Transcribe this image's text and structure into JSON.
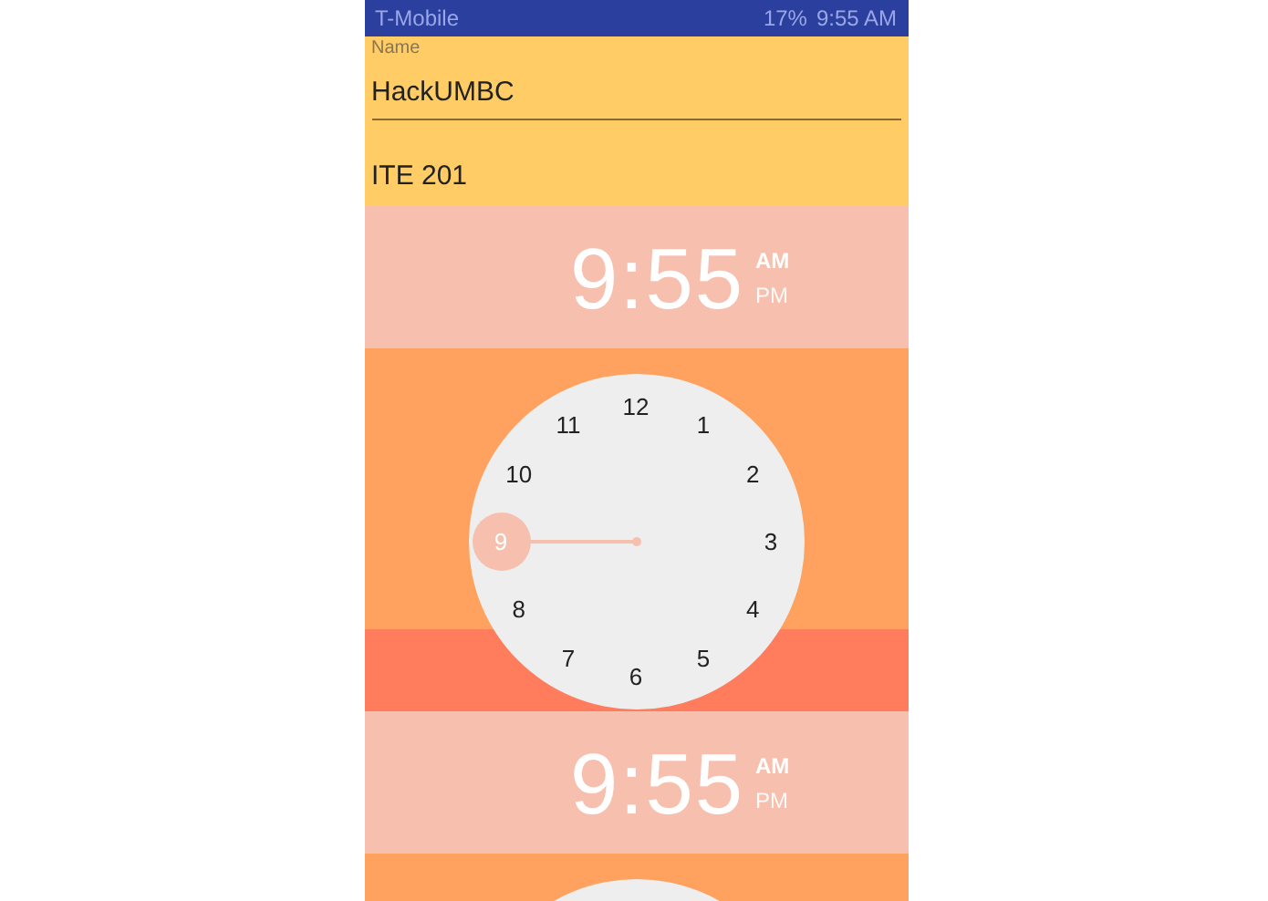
{
  "status_bar": {
    "carrier": "T-Mobile",
    "battery": "17%",
    "time": "9:55 AM"
  },
  "form": {
    "fields": [
      {
        "label": "Name",
        "value": "HackUMBC",
        "focused": true
      },
      {
        "value": "ITE 201",
        "focused": false
      }
    ]
  },
  "pickers": [
    {
      "hour": "9",
      "separator": ":",
      "minute": "55",
      "periods": [
        {
          "label": "AM",
          "selected": true
        },
        {
          "label": "PM",
          "selected": false
        }
      ],
      "dial": {
        "numbers": [
          {
            "label": "12",
            "selected": false
          },
          {
            "label": "1",
            "selected": false
          },
          {
            "label": "2",
            "selected": false
          },
          {
            "label": "3",
            "selected": false
          },
          {
            "label": "4",
            "selected": false
          },
          {
            "label": "5",
            "selected": false
          },
          {
            "label": "6",
            "selected": false
          },
          {
            "label": "7",
            "selected": false
          },
          {
            "label": "8",
            "selected": false
          },
          {
            "label": "9",
            "selected": true
          },
          {
            "label": "10",
            "selected": false
          },
          {
            "label": "11",
            "selected": false
          }
        ]
      }
    },
    {
      "hour": "9",
      "separator": ":",
      "minute": "55",
      "periods": [
        {
          "label": "AM",
          "selected": true
        },
        {
          "label": "PM",
          "selected": false
        }
      ]
    }
  ]
}
